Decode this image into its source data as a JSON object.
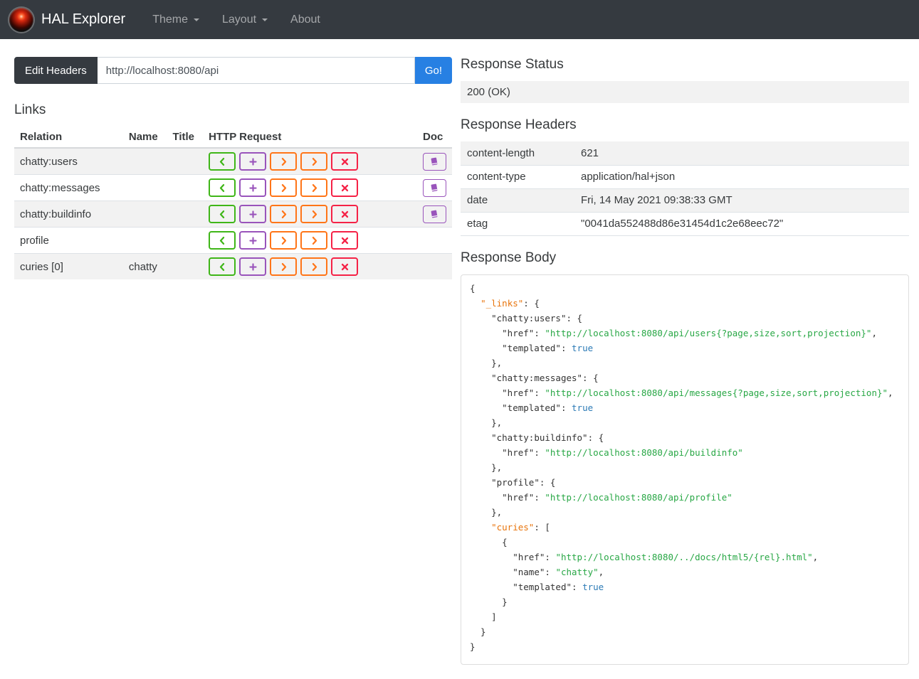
{
  "colors": {
    "dark": "#353a40",
    "primary": "#2780e3",
    "green": "#3fb618",
    "purple": "#9954bb",
    "orange": "#ff7518",
    "red": "#f52246",
    "stripe": "#f2f2f2",
    "json_key": "#e8740c",
    "json_string": "#28a745",
    "json_bool": "#2d7bb6",
    "json_plain": "#333333"
  },
  "navbar": {
    "brand": "HAL Explorer",
    "items": [
      {
        "label": "Theme",
        "caret": true
      },
      {
        "label": "Layout",
        "caret": true
      },
      {
        "label": "About",
        "caret": false
      }
    ]
  },
  "request_bar": {
    "edit_headers_label": "Edit Headers",
    "url": "http://localhost:8080/api",
    "go_label": "Go!"
  },
  "links": {
    "title": "Links",
    "columns": [
      "Relation",
      "Name",
      "Title",
      "HTTP Request",
      "Doc"
    ],
    "http_buttons": [
      {
        "name": "get-button",
        "icon": "chevron-left-icon",
        "color": "#3fb618"
      },
      {
        "name": "post-button",
        "icon": "plus-icon",
        "color": "#9954bb"
      },
      {
        "name": "put-button",
        "icon": "chevron-right-icon",
        "color": "#ff7518"
      },
      {
        "name": "patch-button",
        "icon": "chevron-right-icon",
        "color": "#ff7518"
      },
      {
        "name": "delete-button",
        "icon": "x-icon",
        "color": "#f52246"
      }
    ],
    "doc_button_color": "#9954bb",
    "rows": [
      {
        "relation": "chatty:users",
        "name": "",
        "title": "",
        "doc": true
      },
      {
        "relation": "chatty:messages",
        "name": "",
        "title": "",
        "doc": true
      },
      {
        "relation": "chatty:buildinfo",
        "name": "",
        "title": "",
        "doc": true
      },
      {
        "relation": "profile",
        "name": "",
        "title": "",
        "doc": false
      },
      {
        "relation": "curies [0]",
        "name": "chatty",
        "title": "",
        "doc": false
      }
    ]
  },
  "response_status": {
    "title": "Response Status",
    "value": "200 (OK)"
  },
  "response_headers": {
    "title": "Response Headers",
    "rows": [
      {
        "name": "content-length",
        "value": "621"
      },
      {
        "name": "content-type",
        "value": "application/hal+json"
      },
      {
        "name": "date",
        "value": "Fri, 14 May 2021 09:38:33 GMT"
      },
      {
        "name": "etag",
        "value": "\"0041da552488d86e31454d1c2e68eec72\""
      }
    ]
  },
  "response_body": {
    "title": "Response Body",
    "lines": [
      [
        [
          "p",
          "{"
        ]
      ],
      [
        [
          "p",
          "  "
        ],
        [
          "o",
          "\"_links\""
        ],
        [
          "p",
          ": {"
        ]
      ],
      [
        [
          "p",
          "    "
        ],
        [
          "k",
          "\"chatty:users\""
        ],
        [
          "p",
          ": {"
        ]
      ],
      [
        [
          "p",
          "      "
        ],
        [
          "k",
          "\"href\""
        ],
        [
          "p",
          ": "
        ],
        [
          "s",
          "\"http://localhost:8080/api/users{?page,size,sort,projection}\""
        ],
        [
          "p",
          ","
        ]
      ],
      [
        [
          "p",
          "      "
        ],
        [
          "k",
          "\"templated\""
        ],
        [
          "p",
          ": "
        ],
        [
          "b",
          "true"
        ]
      ],
      [
        [
          "p",
          "    },"
        ]
      ],
      [
        [
          "p",
          "    "
        ],
        [
          "k",
          "\"chatty:messages\""
        ],
        [
          "p",
          ": {"
        ]
      ],
      [
        [
          "p",
          "      "
        ],
        [
          "k",
          "\"href\""
        ],
        [
          "p",
          ": "
        ],
        [
          "s",
          "\"http://localhost:8080/api/messages{?page,size,sort,projection}\""
        ],
        [
          "p",
          ","
        ]
      ],
      [
        [
          "p",
          "      "
        ],
        [
          "k",
          "\"templated\""
        ],
        [
          "p",
          ": "
        ],
        [
          "b",
          "true"
        ]
      ],
      [
        [
          "p",
          "    },"
        ]
      ],
      [
        [
          "p",
          "    "
        ],
        [
          "k",
          "\"chatty:buildinfo\""
        ],
        [
          "p",
          ": {"
        ]
      ],
      [
        [
          "p",
          "      "
        ],
        [
          "k",
          "\"href\""
        ],
        [
          "p",
          ": "
        ],
        [
          "s",
          "\"http://localhost:8080/api/buildinfo\""
        ]
      ],
      [
        [
          "p",
          "    },"
        ]
      ],
      [
        [
          "p",
          "    "
        ],
        [
          "k",
          "\"profile\""
        ],
        [
          "p",
          ": {"
        ]
      ],
      [
        [
          "p",
          "      "
        ],
        [
          "k",
          "\"href\""
        ],
        [
          "p",
          ": "
        ],
        [
          "s",
          "\"http://localhost:8080/api/profile\""
        ]
      ],
      [
        [
          "p",
          "    },"
        ]
      ],
      [
        [
          "p",
          "    "
        ],
        [
          "o",
          "\"curies\""
        ],
        [
          "p",
          ": ["
        ]
      ],
      [
        [
          "p",
          "      {"
        ]
      ],
      [
        [
          "p",
          "        "
        ],
        [
          "k",
          "\"href\""
        ],
        [
          "p",
          ": "
        ],
        [
          "s",
          "\"http://localhost:8080/../docs/html5/{rel}.html\""
        ],
        [
          "p",
          ","
        ]
      ],
      [
        [
          "p",
          "        "
        ],
        [
          "k",
          "\"name\""
        ],
        [
          "p",
          ": "
        ],
        [
          "s",
          "\"chatty\""
        ],
        [
          "p",
          ","
        ]
      ],
      [
        [
          "p",
          "        "
        ],
        [
          "k",
          "\"templated\""
        ],
        [
          "p",
          ": "
        ],
        [
          "b",
          "true"
        ]
      ],
      [
        [
          "p",
          "      }"
        ]
      ],
      [
        [
          "p",
          "    ]"
        ]
      ],
      [
        [
          "p",
          "  }"
        ]
      ],
      [
        [
          "p",
          "}"
        ]
      ]
    ]
  }
}
